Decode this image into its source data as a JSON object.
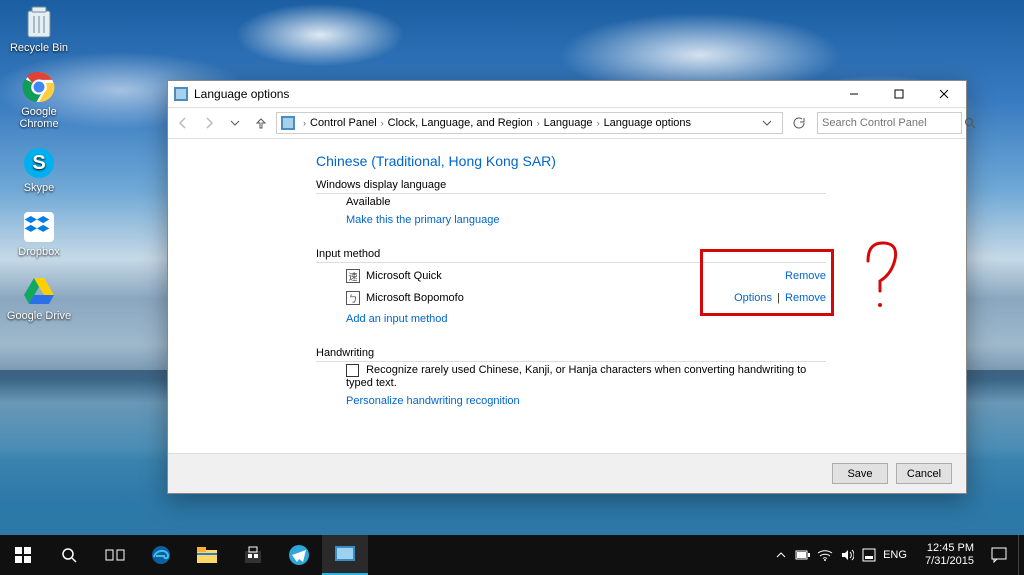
{
  "desktop_icons": [
    {
      "name": "recycle-bin",
      "label": "Recycle Bin"
    },
    {
      "name": "google-chrome",
      "label": "Google Chrome"
    },
    {
      "name": "skype",
      "label": "Skype"
    },
    {
      "name": "dropbox",
      "label": "Dropbox"
    },
    {
      "name": "google-drive",
      "label": "Google Drive"
    }
  ],
  "window": {
    "title": "Language options",
    "breadcrumb": [
      "Control Panel",
      "Clock, Language, and Region",
      "Language",
      "Language options"
    ],
    "search_placeholder": "Search Control Panel",
    "h1": "Chinese (Traditional, Hong Kong SAR)",
    "display_lang": {
      "section": "Windows display language",
      "status": "Available",
      "primary_link": "Make this the primary language"
    },
    "input_method": {
      "section": "Input method",
      "methods": [
        {
          "name": "Microsoft Quick",
          "actions": [
            "Remove"
          ]
        },
        {
          "name": "Microsoft Bopomofo",
          "actions": [
            "Options",
            "Remove"
          ]
        }
      ],
      "add_link": "Add an input method"
    },
    "handwriting": {
      "section": "Handwriting",
      "checkbox_label": "Recognize rarely used Chinese, Kanji, or Hanja characters when converting handwriting to typed text.",
      "personalize_link": "Personalize handwriting recognition"
    },
    "save": "Save",
    "cancel": "Cancel"
  },
  "taskbar": {
    "lang": "ENG",
    "time": "12:45 PM",
    "date": "7/31/2015"
  }
}
